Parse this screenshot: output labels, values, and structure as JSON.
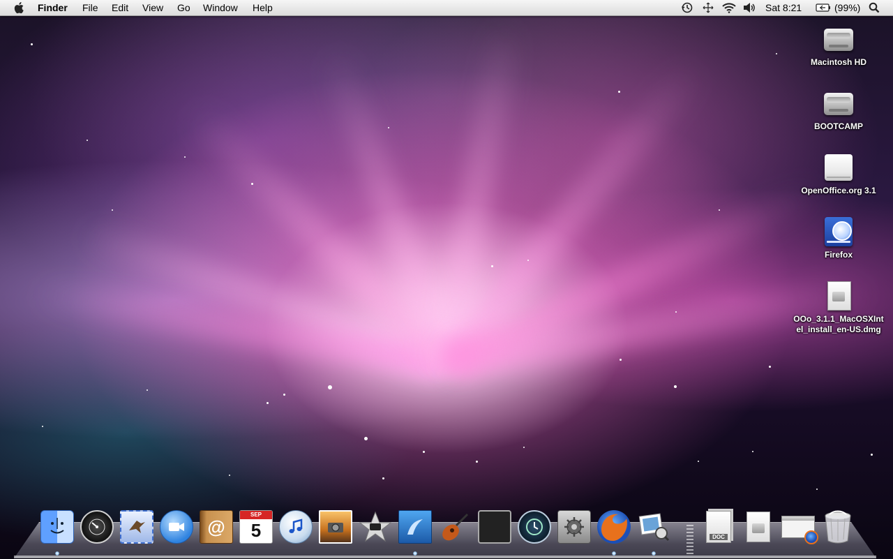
{
  "menubar": {
    "app_name": "Finder",
    "menus": [
      "File",
      "Edit",
      "View",
      "Go",
      "Window",
      "Help"
    ],
    "clock": "Sat 8:21",
    "battery_percent": "(99%)"
  },
  "desktop": {
    "icons": [
      {
        "label": "Macintosh HD",
        "icon": "hard-drive-icon"
      },
      {
        "label": "BOOTCAMP",
        "icon": "hard-drive-icon"
      },
      {
        "label": "OpenOffice.org 3.1",
        "icon": "disk-image-volume-icon"
      },
      {
        "label": "Firefox",
        "icon": "firefox-volume-icon"
      },
      {
        "label": "OOo_3.1.1_MacOSXIntel_install_en-US.dmg",
        "icon": "dmg-file-icon"
      }
    ]
  },
  "dock": {
    "apps": [
      {
        "name": "Finder",
        "icon": "finder-icon",
        "running": true
      },
      {
        "name": "Dashboard",
        "icon": "dashboard-icon",
        "running": false
      },
      {
        "name": "Mail",
        "icon": "mail-icon",
        "running": false
      },
      {
        "name": "iChat",
        "icon": "ichat-icon",
        "running": false
      },
      {
        "name": "Address Book",
        "icon": "address-book-icon",
        "running": false
      },
      {
        "name": "iCal",
        "icon": "ical-icon",
        "running": false,
        "month": "SEP",
        "day": "5"
      },
      {
        "name": "iTunes",
        "icon": "itunes-icon",
        "running": false
      },
      {
        "name": "iPhoto",
        "icon": "iphoto-icon",
        "running": false
      },
      {
        "name": "iMovie",
        "icon": "imovie-icon",
        "running": false
      },
      {
        "name": "iWeb",
        "icon": "iweb-icon",
        "running": true
      },
      {
        "name": "GarageBand",
        "icon": "garageband-icon",
        "running": false
      },
      {
        "name": "Spaces",
        "icon": "spaces-icon",
        "running": false
      },
      {
        "name": "Time Machine",
        "icon": "time-machine-icon",
        "running": false
      },
      {
        "name": "System Preferences",
        "icon": "system-preferences-icon",
        "running": false
      },
      {
        "name": "Firefox",
        "icon": "firefox-icon",
        "running": true
      },
      {
        "name": "Preview",
        "icon": "preview-icon",
        "running": true
      }
    ],
    "stacks": [
      {
        "name": "Documents",
        "icon": "documents-stack-icon",
        "badge": "DOC"
      },
      {
        "name": "Downloads",
        "icon": "downloads-stack-icon"
      },
      {
        "name": "Firefox Window",
        "icon": "minimized-firefox-window-icon"
      },
      {
        "name": "Trash",
        "icon": "trash-icon"
      }
    ]
  }
}
